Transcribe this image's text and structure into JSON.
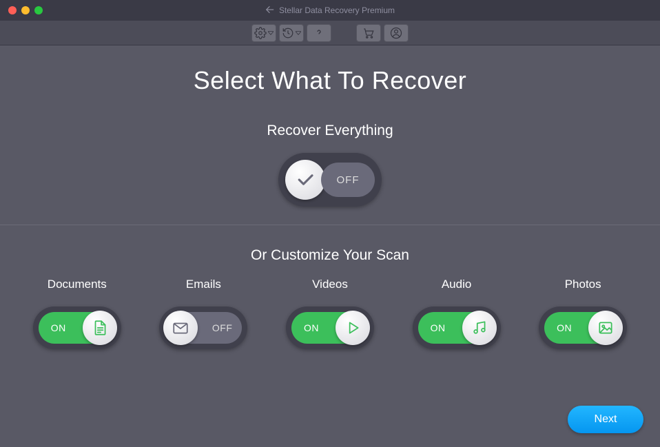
{
  "app_title": "Stellar Data Recovery Premium",
  "page_title": "Select What To Recover",
  "recover_everything": {
    "label": "Recover Everything",
    "state": "off",
    "state_label": "OFF"
  },
  "customize_label": "Or Customize Your Scan",
  "categories": [
    {
      "name": "Documents",
      "state": "on",
      "state_label": "ON",
      "icon": "document-icon"
    },
    {
      "name": "Emails",
      "state": "off",
      "state_label": "OFF",
      "icon": "email-icon"
    },
    {
      "name": "Videos",
      "state": "on",
      "state_label": "ON",
      "icon": "video-icon"
    },
    {
      "name": "Audio",
      "state": "on",
      "state_label": "ON",
      "icon": "audio-icon"
    },
    {
      "name": "Photos",
      "state": "on",
      "state_label": "ON",
      "icon": "photo-icon"
    }
  ],
  "next_button": "Next",
  "colors": {
    "accent_green": "#3cbf5b",
    "accent_blue": "#0aa0f5",
    "bg": "#595965"
  }
}
